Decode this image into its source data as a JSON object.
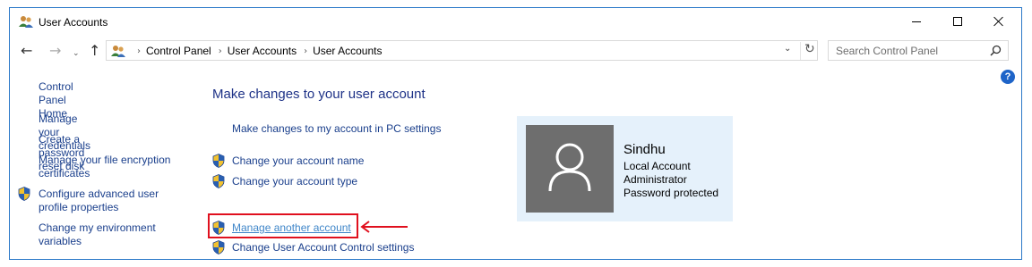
{
  "window": {
    "title": "User Accounts"
  },
  "nav": {
    "breadcrumbs": [
      "Control Panel",
      "User Accounts",
      "User Accounts"
    ],
    "search_placeholder": "Search Control Panel"
  },
  "sidebar": {
    "items": [
      {
        "label": "Control Panel Home",
        "shield": false
      },
      {
        "label": "Manage your credentials",
        "shield": false
      },
      {
        "label": "Create a password reset disk",
        "shield": false
      },
      {
        "label": "Manage your file encryption certificates",
        "shield": false
      },
      {
        "label": "Configure advanced user profile properties",
        "shield": true
      },
      {
        "label": "Change my environment variables",
        "shield": false
      }
    ]
  },
  "main": {
    "title": "Make changes to your user account",
    "links": [
      {
        "label": "Make changes to my account in PC settings",
        "shield": false
      },
      {
        "label": "Change your account name",
        "shield": true
      },
      {
        "label": "Change your account type",
        "shield": true
      },
      {
        "label": "Manage another account",
        "shield": true,
        "highlighted": true
      },
      {
        "label": "Change User Account Control settings",
        "shield": true
      }
    ]
  },
  "user": {
    "name": "Sindhu",
    "details": [
      "Local Account",
      "Administrator",
      "Password protected"
    ]
  },
  "colors": {
    "link": "#1a3f8c",
    "title": "#1e3287",
    "card_bg": "#e5f1fb",
    "highlight": "#e0101e",
    "avatar_bg": "#6e6e6e"
  }
}
